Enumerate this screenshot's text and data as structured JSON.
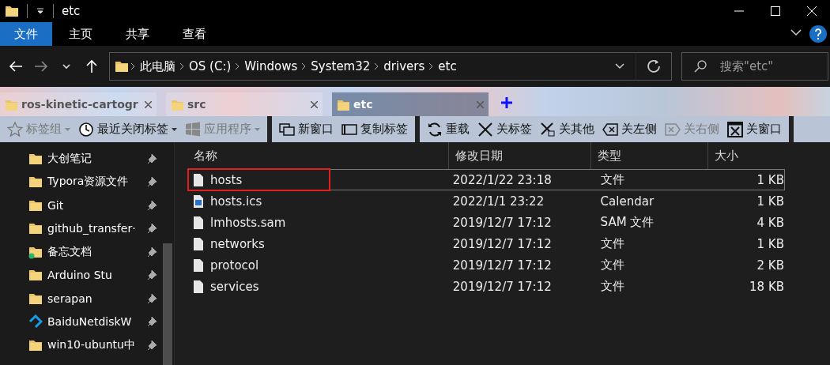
{
  "window": {
    "title": "etc"
  },
  "ribbon_tabs": [
    {
      "label": "文件",
      "selected": true
    },
    {
      "label": "主页",
      "selected": false
    },
    {
      "label": "共享",
      "selected": false
    },
    {
      "label": "查看",
      "selected": false
    }
  ],
  "address": {
    "segments": [
      "此电脑",
      "OS (C:)",
      "Windows",
      "System32",
      "drivers",
      "etc"
    ]
  },
  "search": {
    "placeholder": "搜索\"etc\""
  },
  "browser_tabs": [
    {
      "label": "ros-kinetic-cartogr",
      "selected": false
    },
    {
      "label": "src",
      "selected": false
    },
    {
      "label": "etc",
      "selected": true
    }
  ],
  "toolbar": [
    {
      "label": "标签组",
      "kind": "star",
      "disabled": true,
      "dropdown": true
    },
    {
      "label": "最近关闭标签",
      "kind": "clock",
      "disabled": false,
      "dropdown": true
    },
    {
      "label": "应用程序",
      "kind": "windows",
      "disabled": true,
      "dropdown": true
    },
    {
      "label": "新窗口",
      "kind": "windows2",
      "disabled": false,
      "dropdown": false
    },
    {
      "label": "复制标签",
      "kind": "dup",
      "disabled": false,
      "dropdown": false
    },
    {
      "label": "重载",
      "kind": "reload",
      "disabled": false,
      "dropdown": false
    },
    {
      "label": "关标签",
      "kind": "x",
      "disabled": false,
      "dropdown": false
    },
    {
      "label": "关其他",
      "kind": "xo",
      "disabled": false,
      "dropdown": false
    },
    {
      "label": "关左侧",
      "kind": "xl",
      "disabled": false,
      "dropdown": false
    },
    {
      "label": "关右侧",
      "kind": "xr",
      "disabled": true,
      "dropdown": false
    },
    {
      "label": "关窗口",
      "kind": "xw",
      "disabled": false,
      "dropdown": false
    }
  ],
  "sidebar": {
    "items": [
      {
        "label": "大创笔记",
        "kind": "folder"
      },
      {
        "label": "Typora资源文件",
        "kind": "folder"
      },
      {
        "label": "Git",
        "kind": "folder"
      },
      {
        "label": "github_transfer·",
        "kind": "folder"
      },
      {
        "label": "备忘文档",
        "kind": "cloud-folder"
      },
      {
        "label": "Arduino Stu",
        "kind": "folder"
      },
      {
        "label": "serapan",
        "kind": "folder"
      },
      {
        "label": "BaiduNetdiskW",
        "kind": "app"
      },
      {
        "label": "win10-ubuntu中",
        "kind": "folder"
      }
    ]
  },
  "table": {
    "columns": [
      "名称",
      "修改日期",
      "类型",
      "大小"
    ],
    "rows": [
      {
        "name": "hosts",
        "kind": "file",
        "date": "2022/1/22 23:18",
        "type": "文件",
        "size": "1 KB",
        "selected": true
      },
      {
        "name": "hosts.ics",
        "kind": "calendar",
        "date": "2022/1/1 23:22",
        "type": "Calendar",
        "size": "1 KB",
        "selected": false
      },
      {
        "name": "lmhosts.sam",
        "kind": "file",
        "date": "2019/12/7 17:12",
        "type": "SAM 文件",
        "size": "4 KB",
        "selected": false
      },
      {
        "name": "networks",
        "kind": "file",
        "date": "2019/12/7 17:12",
        "type": "文件",
        "size": "1 KB",
        "selected": false
      },
      {
        "name": "protocol",
        "kind": "file",
        "date": "2019/12/7 17:12",
        "type": "文件",
        "size": "2 KB",
        "selected": false
      },
      {
        "name": "services",
        "kind": "file",
        "date": "2019/12/7 17:12",
        "type": "文件",
        "size": "18 KB",
        "selected": false
      }
    ]
  }
}
